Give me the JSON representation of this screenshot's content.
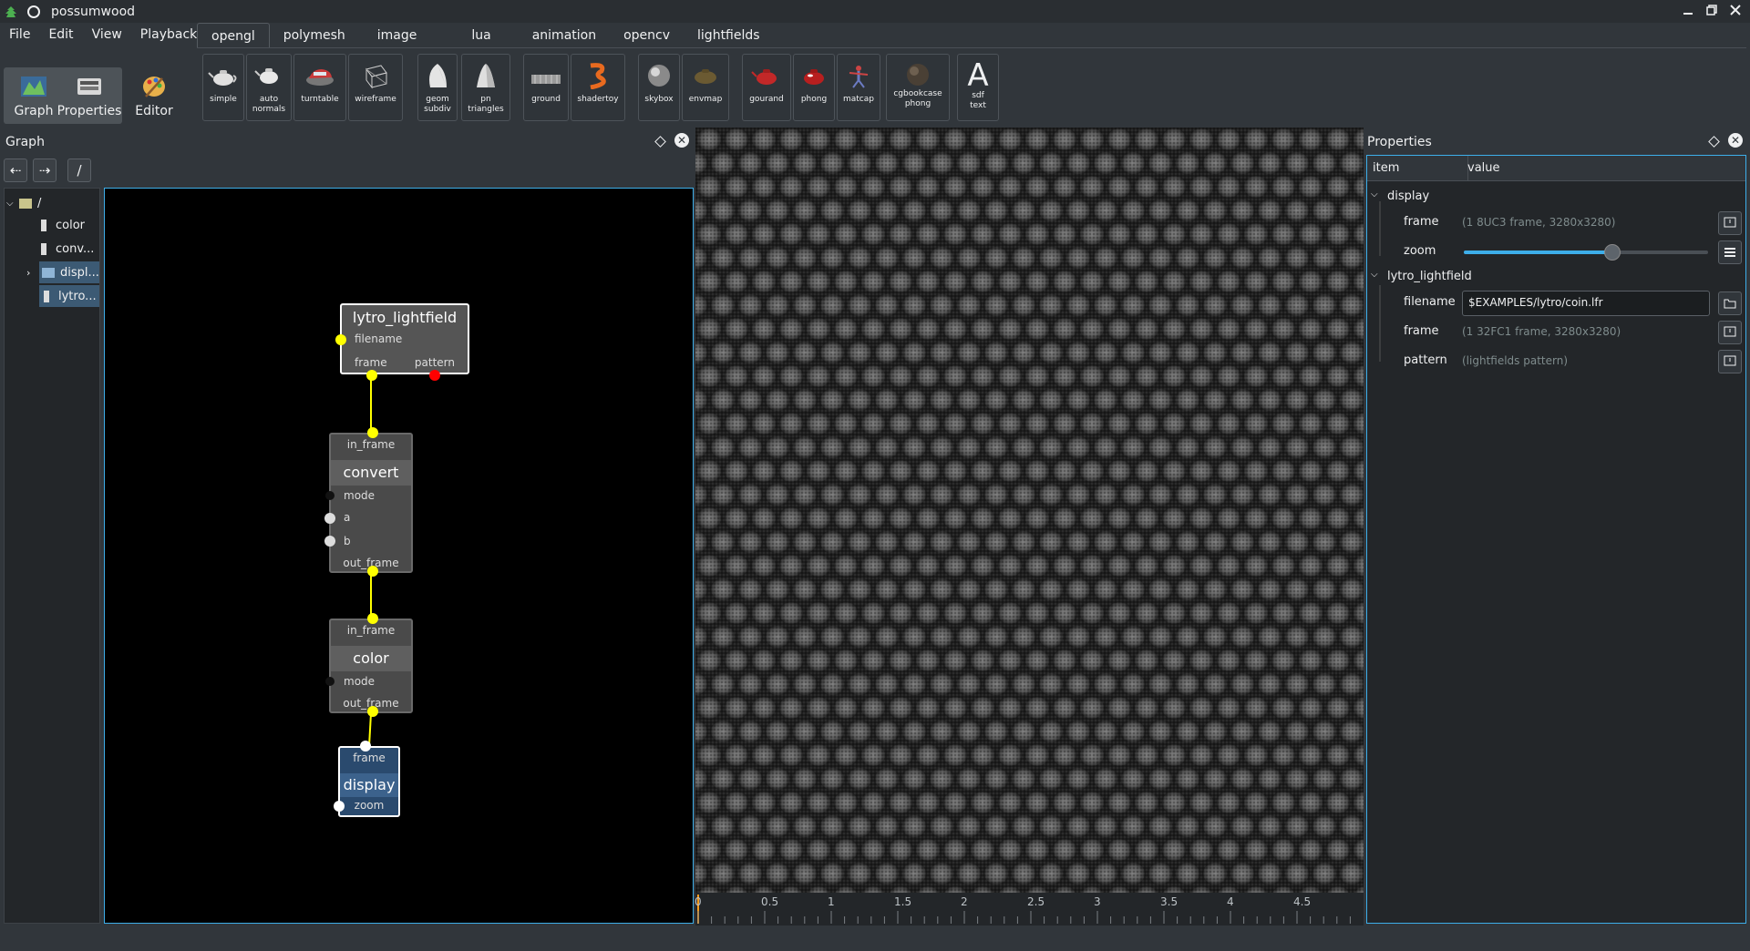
{
  "window": {
    "title": "possumwood"
  },
  "menu": [
    "File",
    "Edit",
    "View",
    "Playback"
  ],
  "tabs": [
    "opengl",
    "polymesh",
    "image",
    "lua",
    "animation",
    "opencv",
    "lightfields"
  ],
  "active_tab": "opengl",
  "tools": [
    {
      "label": "simple",
      "icon": "teapot-icon"
    },
    {
      "label": "auto\nnormals",
      "icon": "teapot-normals-icon"
    },
    {
      "label": "turntable",
      "icon": "car-icon"
    },
    {
      "label": "wireframe",
      "icon": "wireframe-cube-icon"
    },
    {
      "label": "geom\nsubdiv",
      "icon": "subdiv-shape-icon"
    },
    {
      "label": "pn\ntriangles",
      "icon": "pn-triangles-icon"
    },
    {
      "label": "ground",
      "icon": "ground-plane-icon"
    },
    {
      "label": "shadertoy",
      "icon": "shadertoy-icon"
    },
    {
      "label": "skybox",
      "icon": "skybox-sphere-icon"
    },
    {
      "label": "envmap",
      "icon": "envmap-icon"
    },
    {
      "label": "gourand",
      "icon": "red-teapot-icon"
    },
    {
      "label": "phong",
      "icon": "red-teapot-phong-icon"
    },
    {
      "label": "matcap",
      "icon": "matcap-figure-icon"
    },
    {
      "label": "cgbookcase\nphong",
      "icon": "cgbookcase-sphere-icon"
    },
    {
      "label": "sdf\ntext",
      "icon": "letter-a-icon",
      "glyph": "A"
    }
  ],
  "modes": [
    {
      "label": "Graph",
      "icon": "graph-icon",
      "active": true
    },
    {
      "label": "Properties",
      "icon": "properties-icon",
      "active": true
    },
    {
      "label": "Editor",
      "icon": "editor-palette-icon",
      "active": false
    }
  ],
  "graph_panel": {
    "title": "Graph",
    "path": "/",
    "tree": {
      "root": "/",
      "items": [
        {
          "label": "color",
          "selected": false
        },
        {
          "label": "conv...",
          "selected": false
        },
        {
          "label": "displ...",
          "selected": true
        },
        {
          "label": "lytro...",
          "selected": true
        }
      ]
    }
  },
  "nodes": {
    "lytro": {
      "title": "lytro_lightfield",
      "ports": [
        "filename",
        "frame",
        "pattern"
      ]
    },
    "convert": {
      "title": "convert",
      "ports": [
        "in_frame",
        "mode",
        "a",
        "b",
        "out_frame"
      ]
    },
    "color": {
      "title": "color",
      "ports": [
        "in_frame",
        "mode",
        "out_frame"
      ]
    },
    "display": {
      "title": "display",
      "ports": [
        "frame",
        "zoom"
      ]
    }
  },
  "timeline": {
    "ticks": [
      "0",
      "0.5",
      "1",
      "1.5",
      "2",
      "2.5",
      "3",
      "3.5",
      "4",
      "4.5"
    ]
  },
  "properties": {
    "title": "Properties",
    "col_item": "item",
    "col_value": "value",
    "groups": [
      {
        "name": "display",
        "rows": [
          {
            "key": "frame",
            "value": "(1 8UC3 frame, 3280x3280)"
          },
          {
            "key": "zoom",
            "value": "",
            "slider_fraction": 0.61
          }
        ]
      },
      {
        "name": "lytro_lightfield",
        "rows": [
          {
            "key": "filename",
            "value": "$EXAMPLES/lytro/coin.lfr"
          },
          {
            "key": "frame",
            "value": "(1 32FC1 frame, 3280x3280)"
          },
          {
            "key": "pattern",
            "value": "(lightfields pattern)"
          }
        ]
      }
    ]
  },
  "colors": {
    "accent": "#3daee9",
    "port_yellow": "#ffff00",
    "port_red": "#ff0000",
    "display_node": "#2a4a6e"
  }
}
